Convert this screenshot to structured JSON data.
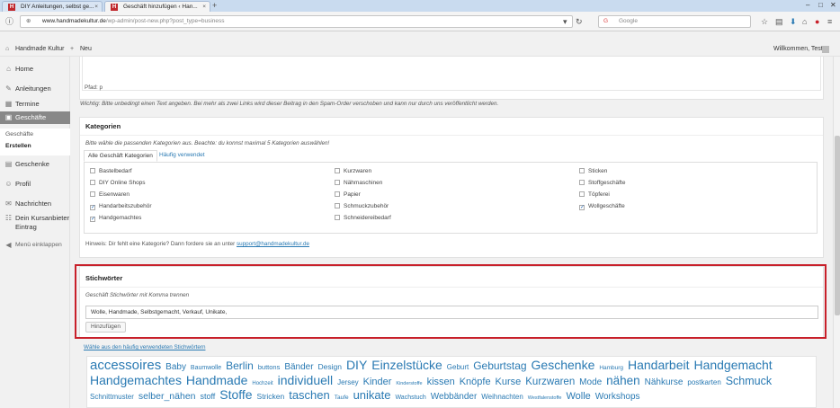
{
  "browser": {
    "tabs": [
      {
        "title": "DIY Anleitungen, selbst ge...",
        "active": false
      },
      {
        "title": "Geschäft hinzufügen ‹ Han...",
        "active": true
      }
    ],
    "new_tab": "+",
    "url_domain": "www.handmadekultur.de",
    "url_path": "/wp-admin/post-new.php?post_type=business",
    "search_placeholder": "Google"
  },
  "adminbar": {
    "site_name": "Handmade Kultur",
    "new_label": "Neu",
    "welcome": "Willkommen, Test"
  },
  "sidebar": {
    "items": [
      {
        "label": "Home",
        "icon": "home-icon"
      },
      {
        "label": "Anleitungen",
        "icon": "wrench-icon"
      },
      {
        "label": "Termine",
        "icon": "calendar-icon"
      },
      {
        "label": "Geschäfte",
        "icon": "briefcase-icon"
      },
      {
        "label": "Geschenke",
        "icon": "gift-icon"
      },
      {
        "label": "Profil",
        "icon": "user-icon"
      },
      {
        "label": "Nachrichten",
        "icon": "chat-icon"
      },
      {
        "label": "Dein Kursanbieter Eintrag",
        "icon": "people-icon"
      },
      {
        "label": "Menü einklappen",
        "icon": "collapse-icon"
      }
    ],
    "submenu": [
      "Geschäfte",
      "Erstellen"
    ]
  },
  "editor": {
    "path_label": "Pfad: p",
    "warning": "Wichtig: Bitte unbedingt einen Text angeben. Bei mehr als zwei Links wird dieser Beitrag in den Spam-Order verschoben und kann nur durch uns veröffentlicht werden."
  },
  "categories": {
    "title": "Kategorien",
    "hint": "Bitte wähle die passenden Kategorien aus. Beachte: du konnst maximal 5 Kategorien auswählen!",
    "tab_all": "Alle Geschäft Kategorien",
    "tab_frequent": "Häufig verwendet",
    "columns": [
      [
        {
          "label": "Bastelbedarf",
          "checked": false
        },
        {
          "label": "DIY Online Shops",
          "checked": false
        },
        {
          "label": "Eisenwaren",
          "checked": false
        },
        {
          "label": "Handarbeitszubehör",
          "checked": true
        },
        {
          "label": "Handgemachtes",
          "checked": true
        }
      ],
      [
        {
          "label": "Kurzwaren",
          "checked": false
        },
        {
          "label": "Nähmaschinen",
          "checked": false
        },
        {
          "label": "Papier",
          "checked": false
        },
        {
          "label": "Schmuckzubehör",
          "checked": false
        },
        {
          "label": "Schneidereibedarf",
          "checked": false
        }
      ],
      [
        {
          "label": "Sticken",
          "checked": false
        },
        {
          "label": "Stoffgeschäfte",
          "checked": false
        },
        {
          "label": "Töpferei",
          "checked": false
        },
        {
          "label": "Wollgeschäfte",
          "checked": true
        }
      ]
    ],
    "missing_hint": "Hinweis: Dir fehlt eine Kategorie? Dann fordere sie an unter",
    "support_email": "support@handmadekultur.de"
  },
  "tags": {
    "title": "Stichwörter",
    "hint": "Geschäft Stichwörter mit Komma trennen",
    "input_value": "Wolle, Handmade, Selbstgemacht, Verkauf, Unikate,",
    "add_button": "Hinzufügen",
    "frequent_link": "Wähle aus den häufig verwendeten Stichwörtern",
    "cloud": [
      {
        "t": "accessoires",
        "s": 15
      },
      {
        "t": "Baby",
        "s": 10
      },
      {
        "t": "Baumwolle",
        "s": 7
      },
      {
        "t": "Berlin",
        "s": 12
      },
      {
        "t": "buttons",
        "s": 7.5
      },
      {
        "t": "Bänder",
        "s": 10
      },
      {
        "t": "Design",
        "s": 8.5
      },
      {
        "t": "DIY",
        "s": 14
      },
      {
        "t": "Einzelstücke",
        "s": 14
      },
      {
        "t": "Geburt",
        "s": 8
      },
      {
        "t": "Geburtstag",
        "s": 12
      },
      {
        "t": "Geschenke",
        "s": 14
      },
      {
        "t": "Hamburg",
        "s": 6.5
      },
      {
        "t": "Handarbeit",
        "s": 14
      },
      {
        "t": "Handgemacht",
        "s": 14
      },
      {
        "t": "Handgemachtes",
        "s": 14
      },
      {
        "t": "Handmade",
        "s": 14
      },
      {
        "t": "Hochzeit",
        "s": 6
      },
      {
        "t": "individuell",
        "s": 14
      },
      {
        "t": "Jersey",
        "s": 8
      },
      {
        "t": "Kinder",
        "s": 11
      },
      {
        "t": "Kinderstoffe",
        "s": 5.5
      },
      {
        "t": "kissen",
        "s": 11
      },
      {
        "t": "Knöpfe",
        "s": 11
      },
      {
        "t": "Kurse",
        "s": 11
      },
      {
        "t": "Kurzwaren",
        "s": 11.5
      },
      {
        "t": "Mode",
        "s": 10
      },
      {
        "t": "nähen",
        "s": 13.5
      },
      {
        "t": "Nähkurse",
        "s": 10
      },
      {
        "t": "postkarten",
        "s": 8
      },
      {
        "t": "Schmuck",
        "s": 12.5
      },
      {
        "t": "Schnittmuster",
        "s": 8
      },
      {
        "t": "selber_nähen",
        "s": 10.5
      },
      {
        "t": "stoff",
        "s": 9
      },
      {
        "t": "Stoffe",
        "s": 14
      },
      {
        "t": "Stricken",
        "s": 8.5
      },
      {
        "t": "taschen",
        "s": 13
      },
      {
        "t": "Taufe",
        "s": 6.5
      },
      {
        "t": "unikate",
        "s": 13
      },
      {
        "t": "Wachstuch",
        "s": 7
      },
      {
        "t": "Webbänder",
        "s": 10
      },
      {
        "t": "Weihnachten",
        "s": 8
      },
      {
        "t": "Westfalenstoffe",
        "s": 5.5
      },
      {
        "t": "Wolle",
        "s": 11
      },
      {
        "t": "Workshops",
        "s": 10
      }
    ]
  },
  "colors": {
    "accent": "#2a7ab3",
    "highlight": "#c8202a",
    "menu_current": "#888888"
  }
}
